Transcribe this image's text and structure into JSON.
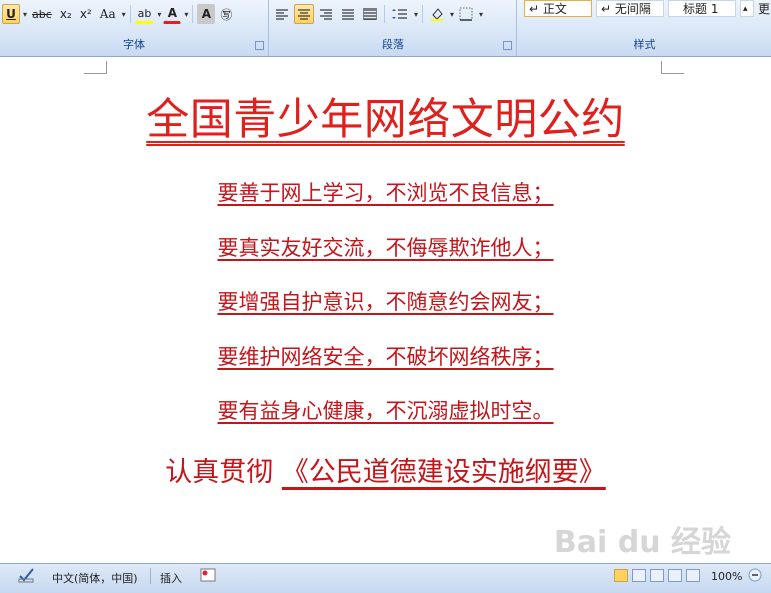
{
  "ribbon": {
    "font_group": {
      "label": "字体",
      "buttons": [
        "U",
        "abc",
        "x₂",
        "x²",
        "Aa",
        "ab",
        "A",
        "A",
        "㊢"
      ]
    },
    "paragraph_group": {
      "label": "段落"
    },
    "styles_group": {
      "label": "样式",
      "styles": [
        "↵ 正文",
        "↵ 无间隔",
        "标题 1"
      ],
      "more": "更"
    }
  },
  "document": {
    "title": "全国青少年网络文明公约",
    "lines": [
      "要善于网上学习，不浏览不良信息；",
      "要真实友好交流，不侮辱欺诈他人；",
      "要增强自护意识，不随意约会网友；",
      "要维护网络安全，不破坏网络秩序；",
      "要有益身心健康，不沉溺虚拟时空。"
    ],
    "closing_prefix": "认真贯彻",
    "closing_underlined": "《公民道德建设实施纲要》",
    "text_color": "#c4151b"
  },
  "watermark": "Bai du 经验",
  "statusbar": {
    "language": "中文(简体，中国)",
    "mode": "插入",
    "zoom": "100%"
  }
}
